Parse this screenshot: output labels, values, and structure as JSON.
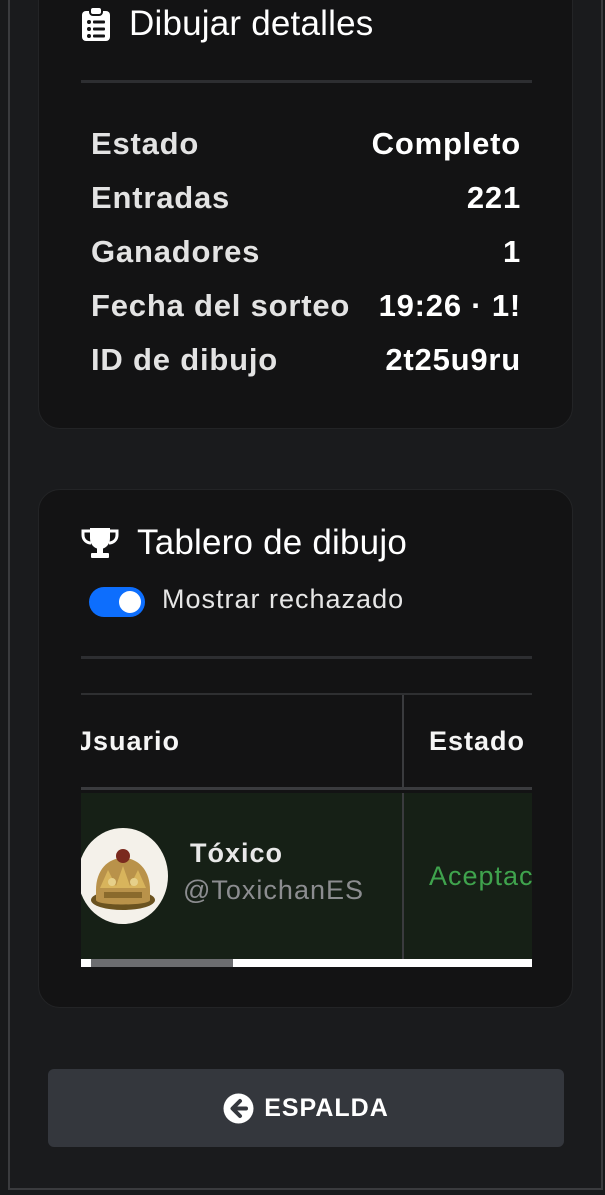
{
  "details": {
    "title": "Dibujar detalles",
    "icon": "clipboard-list-icon",
    "rows": [
      {
        "label": "Estado",
        "value": "Completo"
      },
      {
        "label": "Entradas",
        "value": "221"
      },
      {
        "label": "Ganadores",
        "value": "1"
      },
      {
        "label": "Fecha del sorteo",
        "value": "19:26 · 1!"
      },
      {
        "label": "ID de dibujo",
        "value": "2t25u9ru"
      }
    ]
  },
  "board": {
    "title": "Tablero de dibujo",
    "icon": "trophy-icon",
    "toggle": {
      "label": "Mostrar rechazado",
      "on": true
    },
    "table": {
      "headers": {
        "user": "Jsuario",
        "status": "Estado"
      },
      "rows": [
        {
          "name": "Tóxico",
          "handle": "@ToxichanES",
          "status": "Aceptac"
        }
      ]
    }
  },
  "back_button": {
    "label": "ESPALDA",
    "icon": "arrow-circle-left-icon"
  },
  "colors": {
    "accent": "#0d6efd",
    "accepted": "#3fa34d",
    "button": "#34373d"
  }
}
